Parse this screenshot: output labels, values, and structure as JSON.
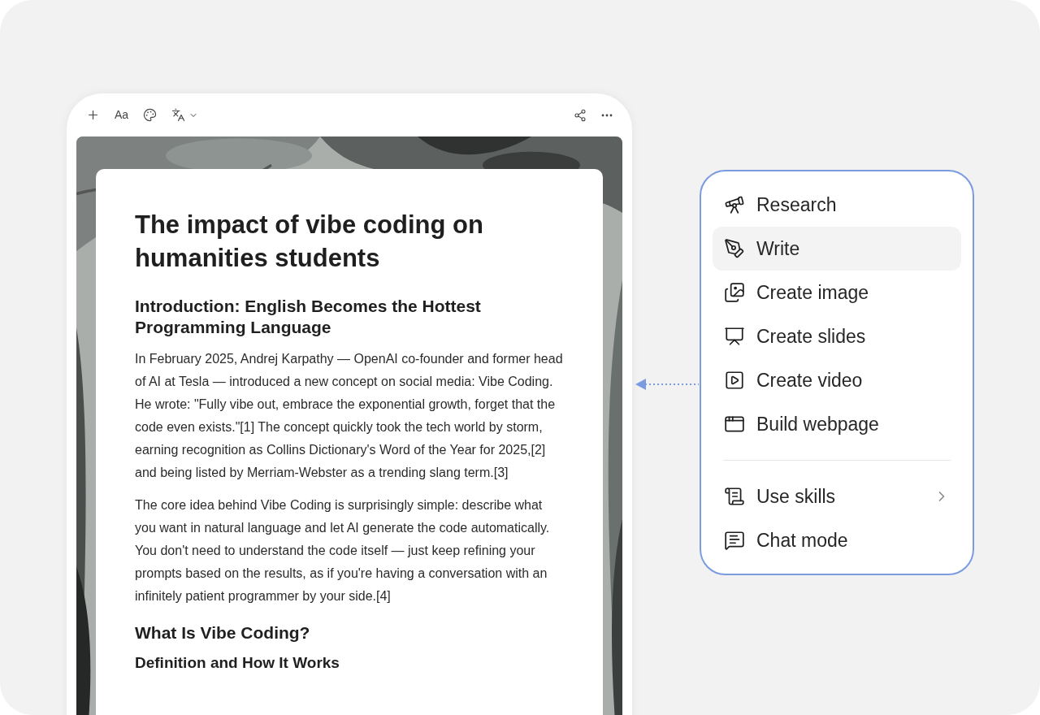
{
  "toolbar": {
    "font_label": "Aa"
  },
  "document": {
    "title": "The impact of vibe coding on humanities students",
    "blocks": [
      {
        "kind": "h2",
        "text": "Introduction: English Becomes the Hottest Programming Language"
      },
      {
        "kind": "p",
        "text": "In February 2025, Andrej Karpathy — OpenAI co-founder and former head of AI at Tesla — introduced a new concept on social media: Vibe Coding. He wrote: \"Fully vibe out, embrace the exponential growth, forget that the code even exists.\"[1] The concept quickly took the tech world by storm, earning recognition as Collins Dictionary's Word of the Year for 2025,[2] and being listed by Merriam-Webster as a trending slang term.[3]"
      },
      {
        "kind": "p",
        "text": "The core idea behind Vibe Coding is surprisingly simple: describe what you want in natural language and let AI generate the code automatically. You don't need to understand the code itself — just keep refining your prompts based on the results, as if you're having a conversation with an infinitely patient programmer by your side.[4]"
      },
      {
        "kind": "h2",
        "text": "What Is Vibe Coding?"
      },
      {
        "kind": "h3",
        "text": "Definition and How It Works"
      }
    ]
  },
  "menu": {
    "groups": [
      [
        {
          "label": "Research",
          "selected": false,
          "submenu": false
        },
        {
          "label": "Write",
          "selected": true,
          "submenu": false
        },
        {
          "label": "Create image",
          "selected": false,
          "submenu": false
        },
        {
          "label": "Create slides",
          "selected": false,
          "submenu": false
        },
        {
          "label": "Create video",
          "selected": false,
          "submenu": false
        },
        {
          "label": "Build webpage",
          "selected": false,
          "submenu": false
        }
      ],
      [
        {
          "label": "Use skills",
          "selected": false,
          "submenu": true
        },
        {
          "label": "Chat mode",
          "selected": false,
          "submenu": false
        }
      ]
    ]
  }
}
